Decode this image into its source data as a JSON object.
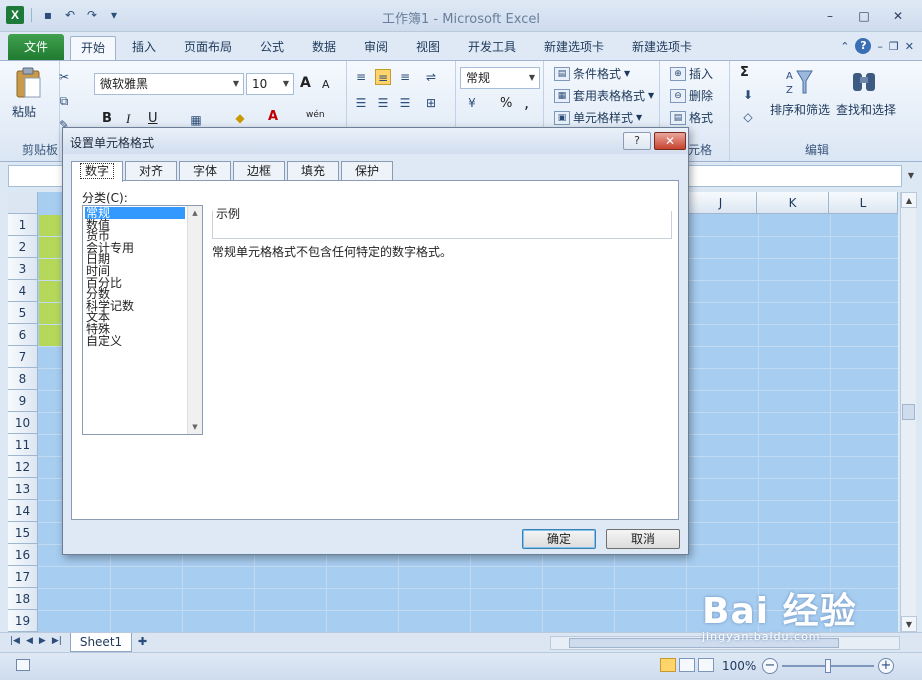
{
  "window": {
    "title": "工作簿1 - Microsoft Excel",
    "logo": "X",
    "controls": [
      "–",
      "□",
      "✕"
    ]
  },
  "ribbon_tabs": {
    "file": "文件",
    "items": [
      "开始",
      "插入",
      "页面布局",
      "公式",
      "数据",
      "审阅",
      "视图",
      "开发工具",
      "新建选项卡",
      "新建选项卡"
    ]
  },
  "ribbon": {
    "clipboard": {
      "paste": "粘贴",
      "label": "剪贴板"
    },
    "font": {
      "name": "微软雅黑",
      "size": "10",
      "grow": "A",
      "shrink": "A",
      "bold": "B",
      "italic": "I",
      "underline": "U",
      "color": "A",
      "phonetic": "wén"
    },
    "number": {
      "format": "常规",
      "percent": "%",
      "comma": ","
    },
    "styles": {
      "conditional": "条件格式",
      "table": "套用表格格式",
      "cell": "单元格样式"
    },
    "cells": {
      "insert": "插入",
      "delete": "删除",
      "format": "格式",
      "label": "元格"
    },
    "editing": {
      "sigma": "Σ",
      "sort": "排序和筛选",
      "find": "查找和选择",
      "label": "编辑"
    }
  },
  "sheet": {
    "columns": [
      "J",
      "K",
      "L"
    ],
    "rows": [
      "1",
      "2",
      "3",
      "4",
      "5",
      "6",
      "7",
      "8",
      "9",
      "10",
      "11",
      "12",
      "13",
      "14",
      "15",
      "16",
      "17",
      "18",
      "19"
    ],
    "tab_name": "Sheet1"
  },
  "status": {
    "zoom": "100%"
  },
  "watermark": {
    "main": "Bai 经验",
    "sub": "jingyan.baidu.com"
  },
  "dialog": {
    "title": "设置单元格格式",
    "help": "?",
    "close": "✕",
    "tabs": [
      "数字",
      "对齐",
      "字体",
      "边框",
      "填充",
      "保护"
    ],
    "category_label": "分类(C):",
    "categories": [
      "常规",
      "数值",
      "货币",
      "会计专用",
      "日期",
      "时间",
      "百分比",
      "分数",
      "科学记数",
      "文本",
      "特殊",
      "自定义"
    ],
    "selected_category": 0,
    "sample_label": "示例",
    "description": "常规单元格格式不包含任何特定的数字格式。",
    "ok": "确定",
    "cancel": "取消"
  }
}
